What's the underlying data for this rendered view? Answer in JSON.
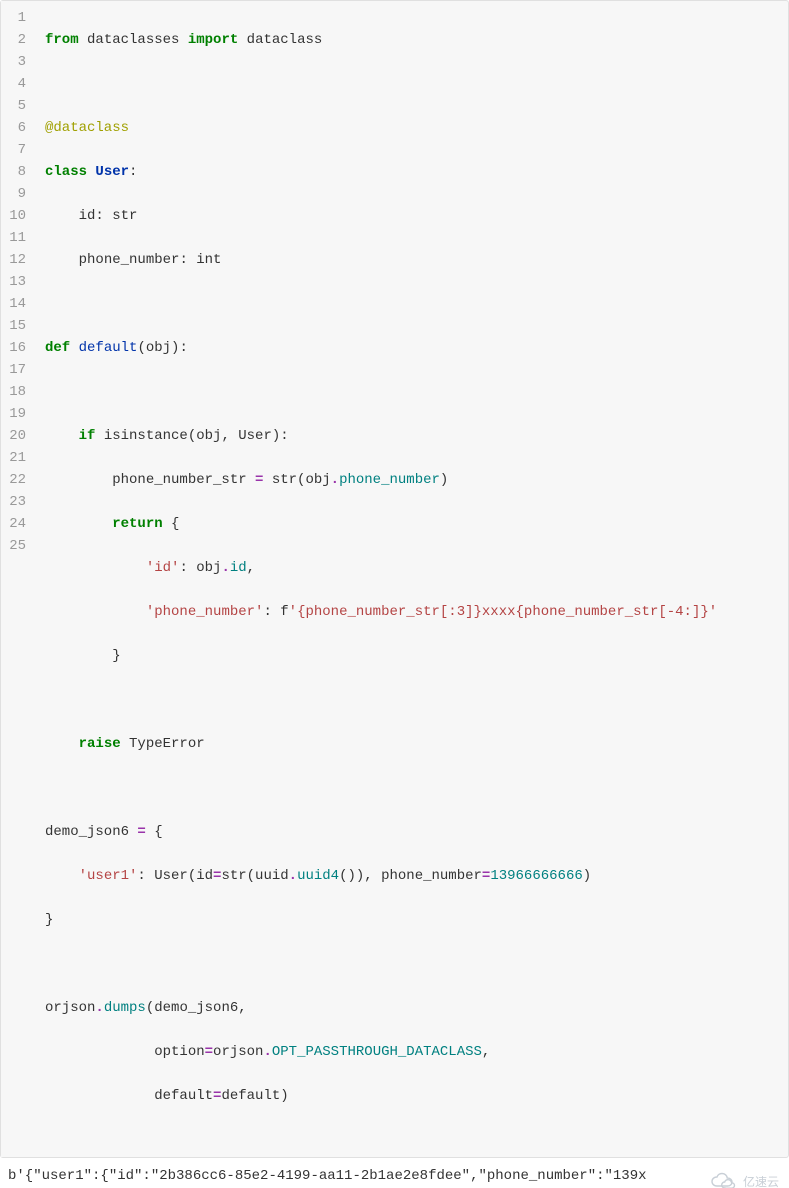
{
  "code": {
    "line_count": 25,
    "lines": {
      "l1": {
        "a": "from",
        "b": "dataclasses",
        "c": "import",
        "d": "dataclass"
      },
      "l3": {
        "a": "@dataclass"
      },
      "l4": {
        "a": "class",
        "b": "User",
        "c": ":"
      },
      "l5": {
        "a": "id",
        "b": ":",
        "c": "str"
      },
      "l6": {
        "a": "phone_number",
        "b": ":",
        "c": "int"
      },
      "l8": {
        "a": "def",
        "b": "default",
        "c": "(obj):"
      },
      "l10": {
        "a": "if",
        "b": " isinstance(obj, User):"
      },
      "l11": {
        "a": "phone_number_str ",
        "b": "=",
        "c": " str(obj",
        "d": ".",
        "e": "phone_number",
        "f": ")"
      },
      "l12": {
        "a": "return",
        "b": " {"
      },
      "l13": {
        "a": "'id'",
        "b": ": obj",
        "c": ".",
        "d": "id",
        "e": ","
      },
      "l14": {
        "a": "'phone_number'",
        "b": ": f",
        "c": "'{phone_number_str[:3]}",
        "d": "xxxx",
        "e": "{phone_number_str[-4:]}'"
      },
      "l15": {
        "a": "}"
      },
      "l17": {
        "a": "raise",
        "b": " TypeError"
      },
      "l19": {
        "a": "demo_json6 ",
        "b": "=",
        "c": " {"
      },
      "l20": {
        "a": "'user1'",
        "b": ": User(id",
        "c": "=",
        "d": "str(uuid",
        "e": ".",
        "f": "uuid4",
        "g": "()), phone_number",
        "h": "=",
        "i": "13966666666",
        "j": ")"
      },
      "l21": {
        "a": "}"
      },
      "l23": {
        "a": "orjson",
        "b": ".",
        "c": "dumps",
        "d": "(demo_json6,"
      },
      "l24": {
        "a": "option",
        "b": "=",
        "c": "orjson",
        "d": ".",
        "e": "OPT_PASSTHROUGH_DATACLASS",
        "f": ","
      },
      "l25": {
        "a": "default",
        "b": "=",
        "c": "default)"
      }
    }
  },
  "output": {
    "text": "b'{\"user1\":{\"id\":\"2b386cc6-85e2-4199-aa11-2b1ae2e8fdee\",\"phone_number\":\"139x"
  },
  "watermark": {
    "text": "亿速云"
  }
}
